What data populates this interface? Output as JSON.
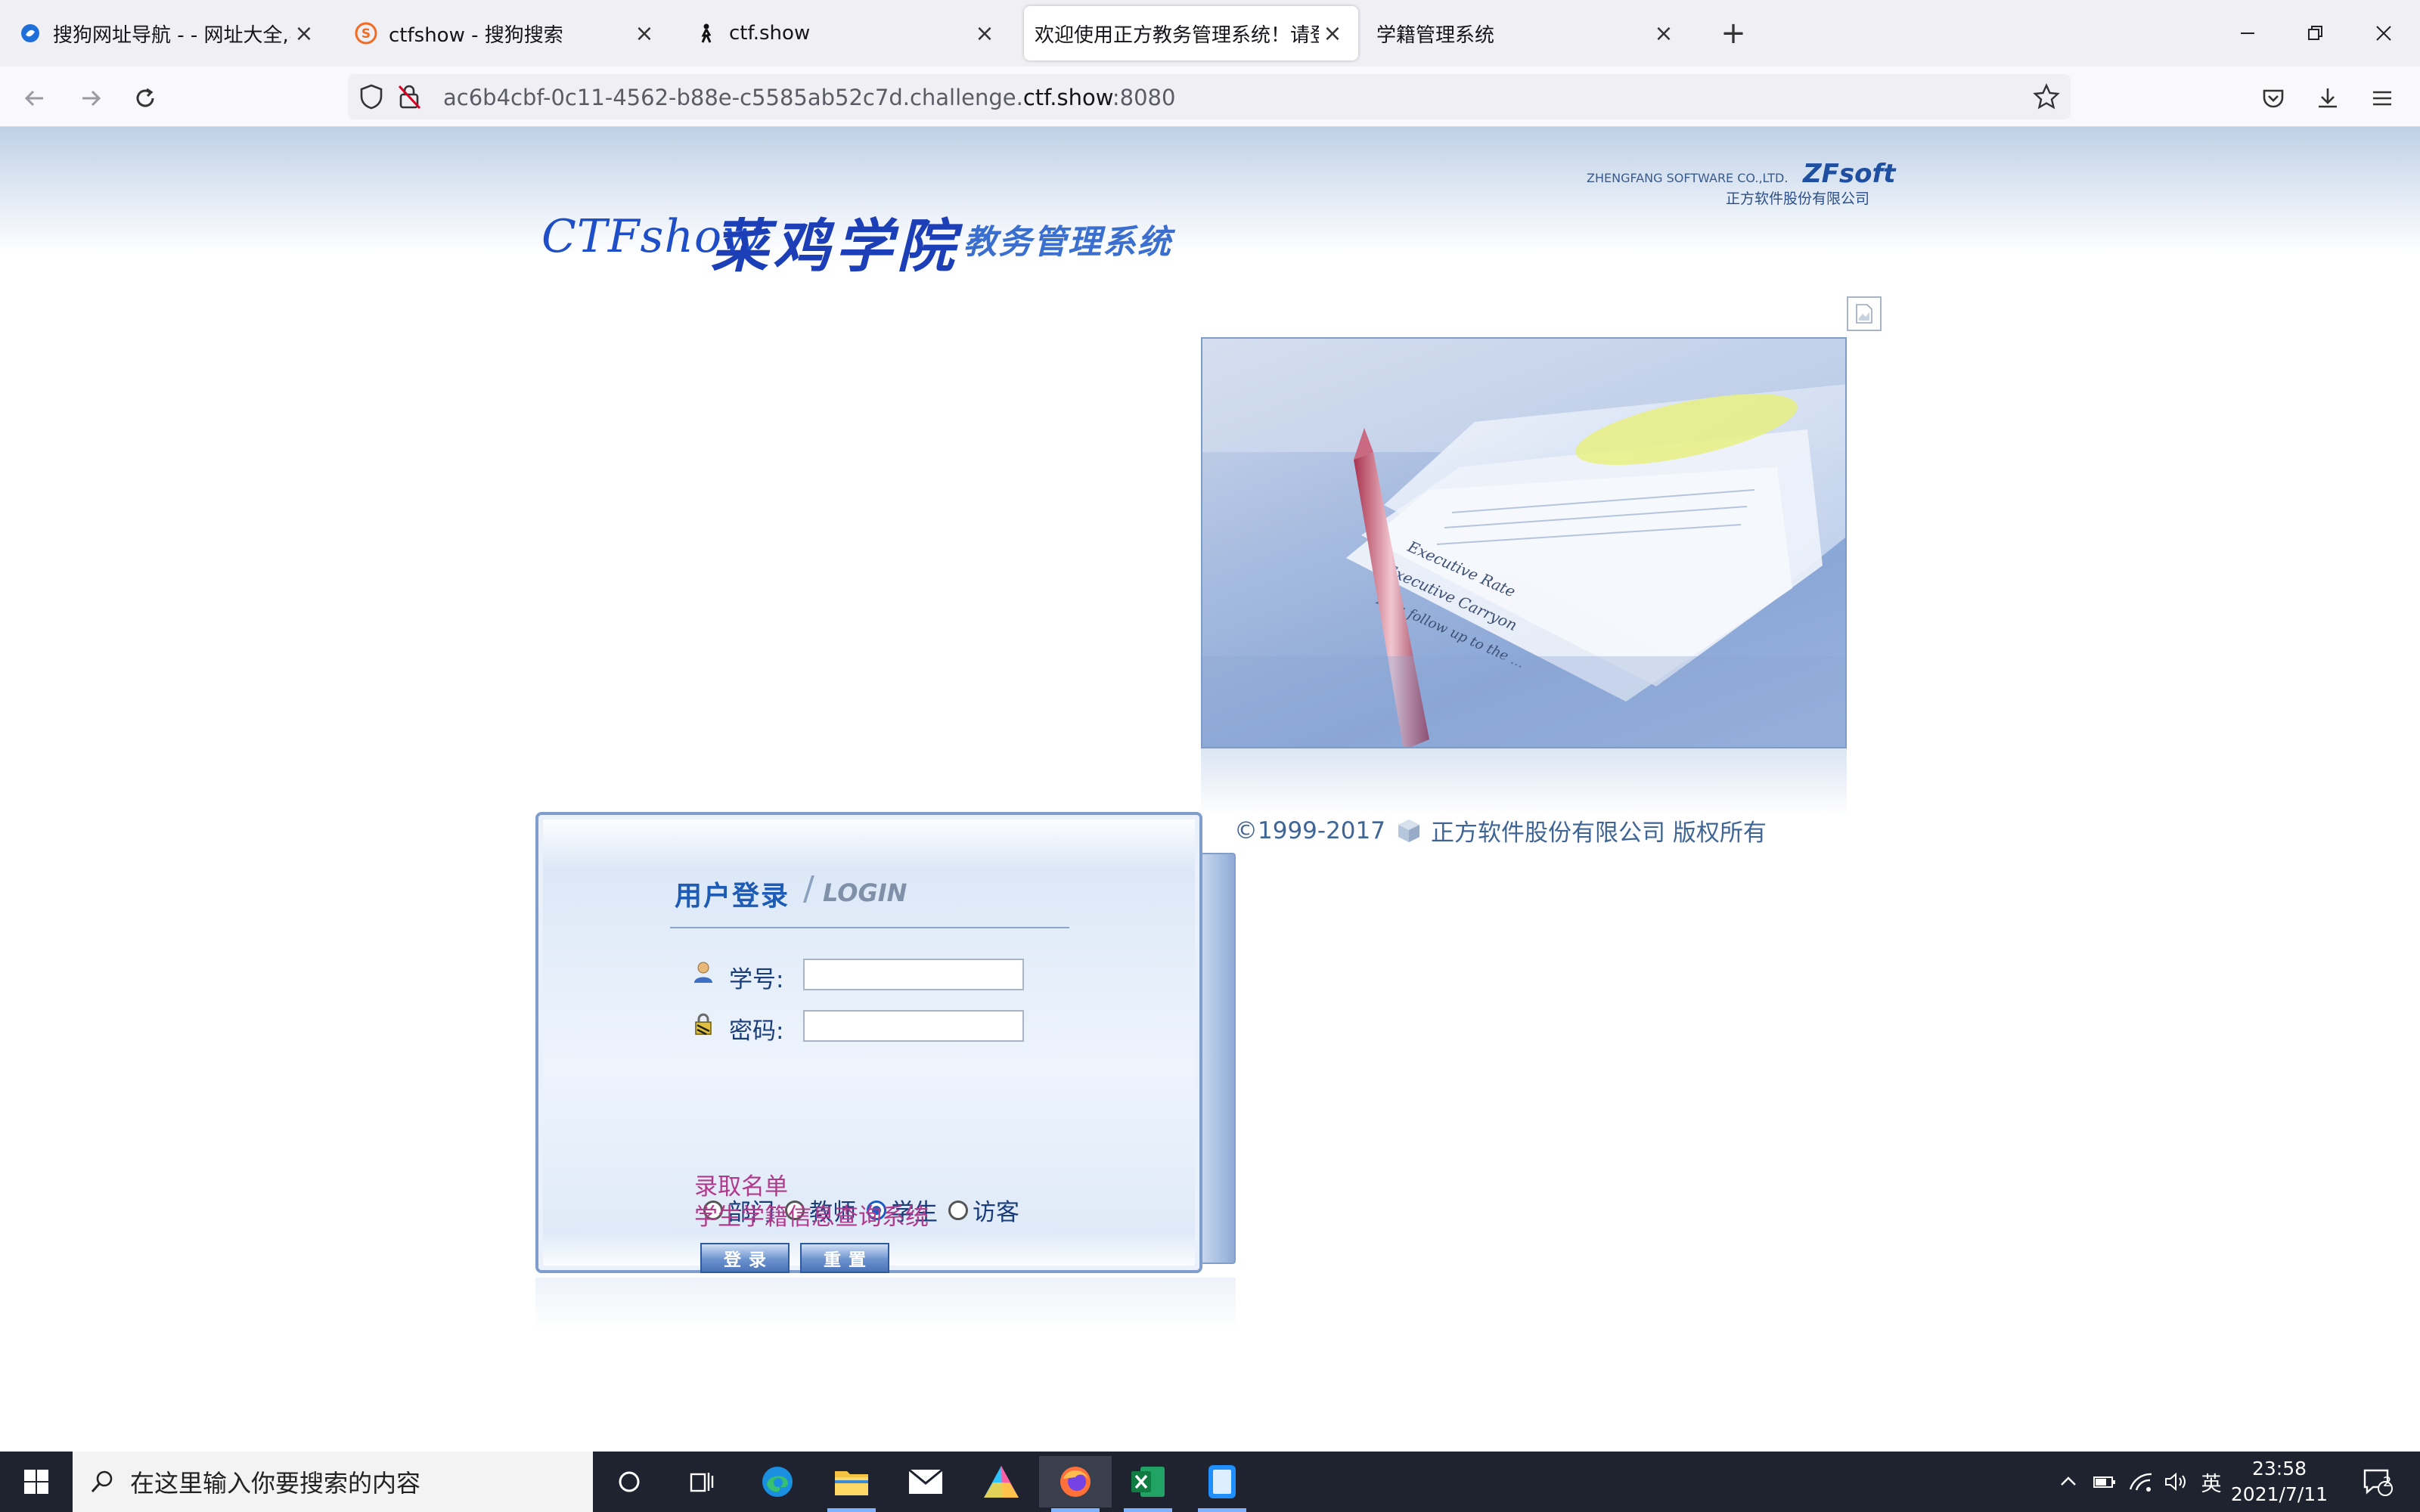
{
  "browser": {
    "tabs": [
      {
        "title": "搜狗网址导航 - - 网址大全,实用",
        "icon": "sogou-nav-icon",
        "active": false
      },
      {
        "title": "ctfshow - 搜狗搜索",
        "icon": "sogou-search-icon",
        "active": false
      },
      {
        "title": "ctf.show",
        "icon": "ctfshow-icon",
        "active": false
      },
      {
        "title": "欢迎使用正方教务管理系统！请登录",
        "icon": "none",
        "active": true
      },
      {
        "title": "学籍管理系统",
        "icon": "none",
        "active": false
      }
    ],
    "url_prefix": "ac6b4cbf-0c11-4562-b88e-c5585ab52c7d.challenge.",
    "url_domain": "ctf.show",
    "url_suffix": ":8080"
  },
  "header": {
    "logo_ctf": "CTFshow",
    "logo_school": "菜鸡学院",
    "logo_system": "教务管理系统",
    "vendor_en": "ZHENGFANG SOFTWARE CO.,LTD.",
    "vendor_brand": "ZFsoft",
    "vendor_cn": "正方软件股份有限公司"
  },
  "copyright": {
    "years": "©1999-2017",
    "company": "正方软件股份有限公司 版权所有"
  },
  "login": {
    "title_cn": "用户登录",
    "title_en": "LOGIN",
    "username_label": "学号:",
    "password_label": "密码:",
    "username_value": "",
    "password_value": "",
    "roles": [
      {
        "label": "部门",
        "selected": false
      },
      {
        "label": "教师",
        "selected": false
      },
      {
        "label": "学生",
        "selected": true
      },
      {
        "label": "访客",
        "selected": false
      }
    ],
    "login_button": "登录",
    "reset_button": "重置",
    "links": [
      "录取名单",
      "学生学籍信息查询系统"
    ]
  },
  "taskbar": {
    "search_placeholder": "在这里输入你要搜索的内容",
    "ime": "英",
    "time": "23:58",
    "date": "2021/7/11",
    "notification_count": "2"
  },
  "colors": {
    "accent_blue": "#1e5bb5",
    "link_purple": "#b03a8c",
    "tab_strip": "#f0f0f4"
  }
}
